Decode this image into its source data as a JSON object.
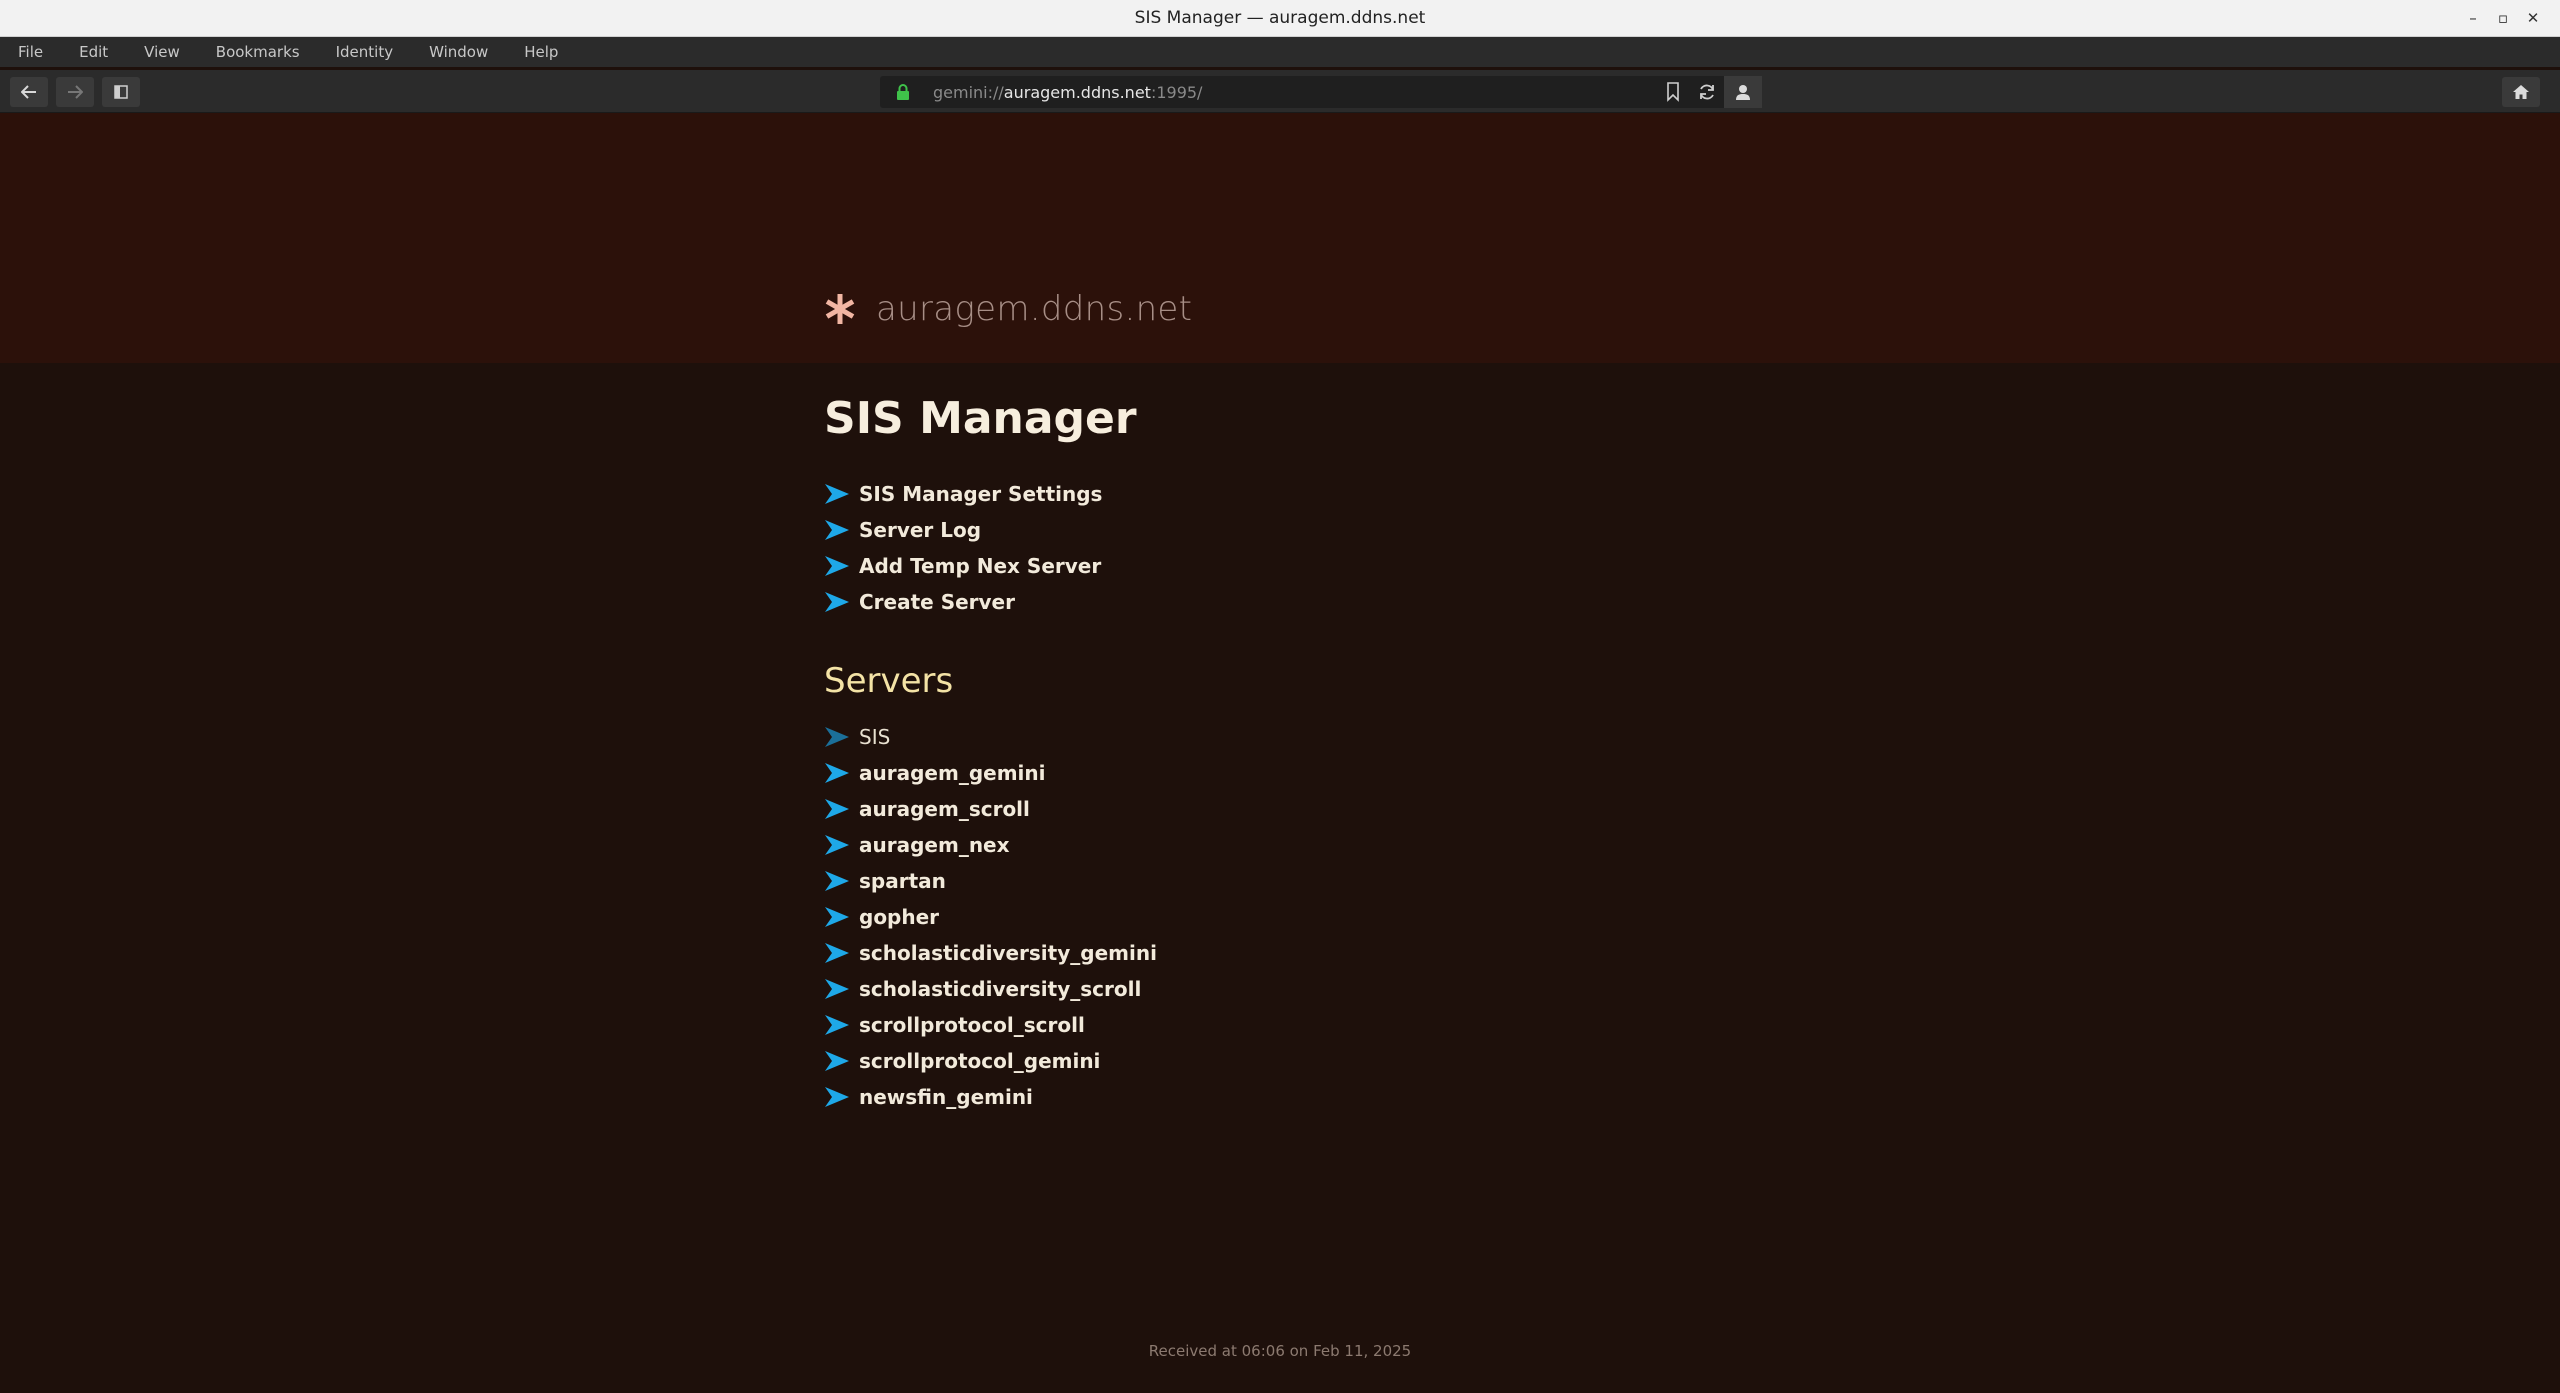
{
  "window": {
    "title": "SIS Manager — auragem.ddns.net",
    "controls": {
      "minimize": "–",
      "maximize": "▫",
      "close": "✕"
    }
  },
  "menu": [
    "File",
    "Edit",
    "View",
    "Bookmarks",
    "Identity",
    "Window",
    "Help"
  ],
  "toolbar": {
    "url_scheme": "gemini://",
    "url_host": "auragem.ddns.net",
    "url_rest": ":1995/",
    "back_icon": "arrow-left-icon",
    "forward_icon": "arrow-right-icon",
    "sidebar_icon": "sidebar-toggle-icon",
    "lock_icon": "lock-icon",
    "bookmark_icon": "bookmark-icon",
    "reload_icon": "reload-icon",
    "identity_icon": "person-icon",
    "home_icon": "home-icon"
  },
  "page": {
    "site_icon": "asterisk-icon",
    "site_name": "auragem.ddns.net",
    "heading": "SIS Manager",
    "actions": [
      "SIS Manager Settings",
      "Server Log",
      "Add Temp Nex Server",
      "Create Server"
    ],
    "servers_heading": "Servers",
    "servers": [
      {
        "label": "SIS",
        "visited": true
      },
      {
        "label": "auragem_gemini",
        "visited": false
      },
      {
        "label": "auragem_scroll",
        "visited": false
      },
      {
        "label": "auragem_nex",
        "visited": false
      },
      {
        "label": "spartan",
        "visited": false
      },
      {
        "label": "gopher",
        "visited": false
      },
      {
        "label": "scholasticdiversity_gemini",
        "visited": false
      },
      {
        "label": "scholasticdiversity_scroll",
        "visited": false
      },
      {
        "label": "scrollprotocol_scroll",
        "visited": false
      },
      {
        "label": "scrollprotocol_gemini",
        "visited": false
      },
      {
        "label": "newsfin_gemini",
        "visited": false
      }
    ],
    "footer": "Received at 06:06 on Feb 11, 2025"
  },
  "colors": {
    "background": "#1e100b",
    "banner": "#2c110a",
    "link_arrow": "#1ea8e8",
    "visited_arrow": "#1b6f99",
    "heading": "#f7eede",
    "subheading": "#f4e3a6",
    "site_icon": "#f2b6a3"
  }
}
